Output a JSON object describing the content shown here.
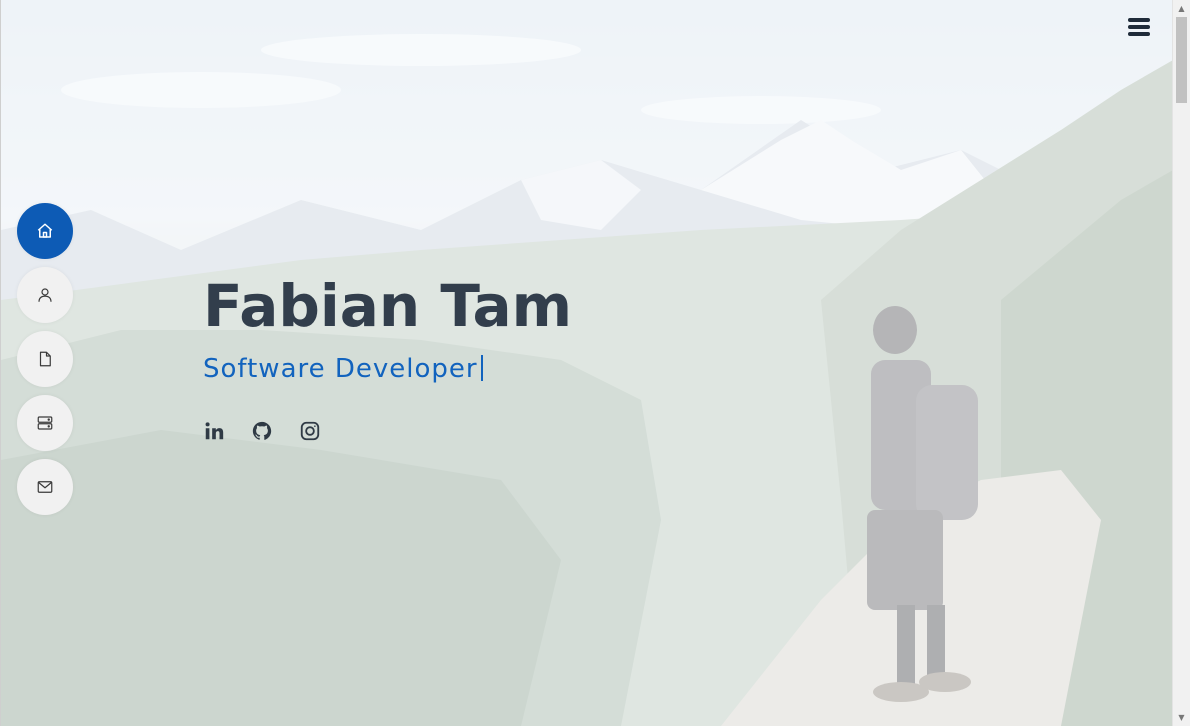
{
  "hero": {
    "name": "Fabian Tam",
    "role": "Software Developer"
  },
  "nav": {
    "items": [
      {
        "id": "home",
        "icon": "home-icon",
        "active": true
      },
      {
        "id": "about",
        "icon": "user-icon",
        "active": false
      },
      {
        "id": "resume",
        "icon": "file-icon",
        "active": false
      },
      {
        "id": "portfolio",
        "icon": "server-icon",
        "active": false
      },
      {
        "id": "contact",
        "icon": "mail-icon",
        "active": false
      }
    ]
  },
  "social": [
    {
      "icon": "linkedin-icon"
    },
    {
      "icon": "github-icon"
    },
    {
      "icon": "instagram-icon"
    }
  ],
  "menu": {
    "icon": "hamburger-icon"
  },
  "colors": {
    "accent": "#0d5bb5",
    "name_text": "#323e4c",
    "role_text": "#1263be",
    "nav_bg": "#f1f1f1"
  }
}
